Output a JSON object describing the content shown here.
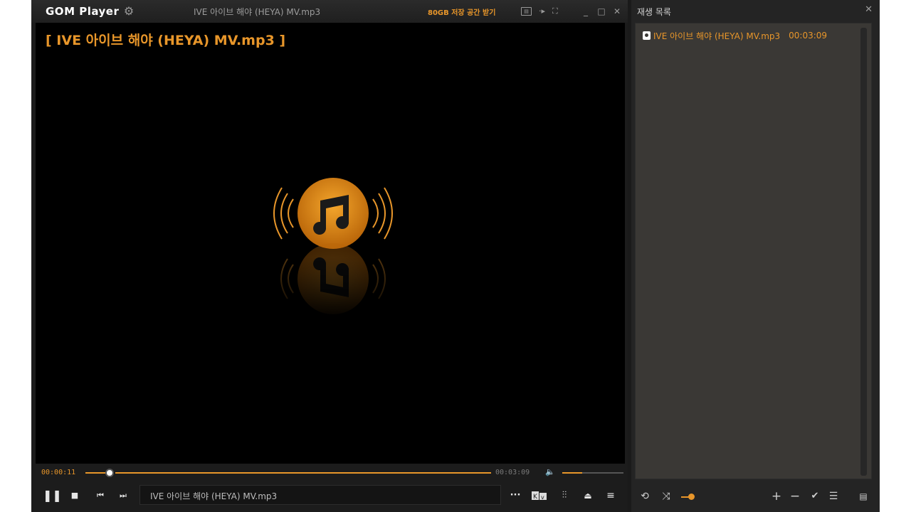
{
  "app": {
    "logo": "GOM Player",
    "window_title": "IVE 아이브 해야 (HEYA) MV.mp3",
    "promo": "80GB 저장 공간 받기"
  },
  "video": {
    "overlay_title": "[ IVE 아이브 해야 (HEYA) MV.mp3 ]"
  },
  "seek": {
    "current_time": "00:00:11",
    "total_time": "00:03:09",
    "progress_fraction": 0.058,
    "volume_fraction": 0.33
  },
  "controls": {
    "now_playing": "IVE 아이브 해야 (HEYA) MV.mp3",
    "more_label": "···"
  },
  "playlist": {
    "title": "재생 목록",
    "items": [
      {
        "name": "IVE 아이브 해야 (HEYA) MV.mp3",
        "duration": "00:03:09"
      }
    ]
  },
  "colors": {
    "accent": "#e8962a",
    "background": "#1c1c1c",
    "playlist_bg": "#3a3835"
  },
  "icons": {
    "settings": "gear-icon",
    "close": "close-icon",
    "minimize": "minimize-icon",
    "maximize": "maximize-icon",
    "pause": "pause-icon",
    "stop": "stop-icon",
    "previous": "previous-icon",
    "next": "next-icon",
    "volume": "speaker-icon",
    "equalizer": "equalizer-icon",
    "eject": "eject-icon",
    "menu": "menu-icon",
    "repeat": "repeat-icon",
    "shuffle": "shuffle-icon",
    "add": "plus-icon",
    "remove": "minus-icon",
    "check": "check-icon",
    "list": "list-icon",
    "save": "document-icon"
  }
}
